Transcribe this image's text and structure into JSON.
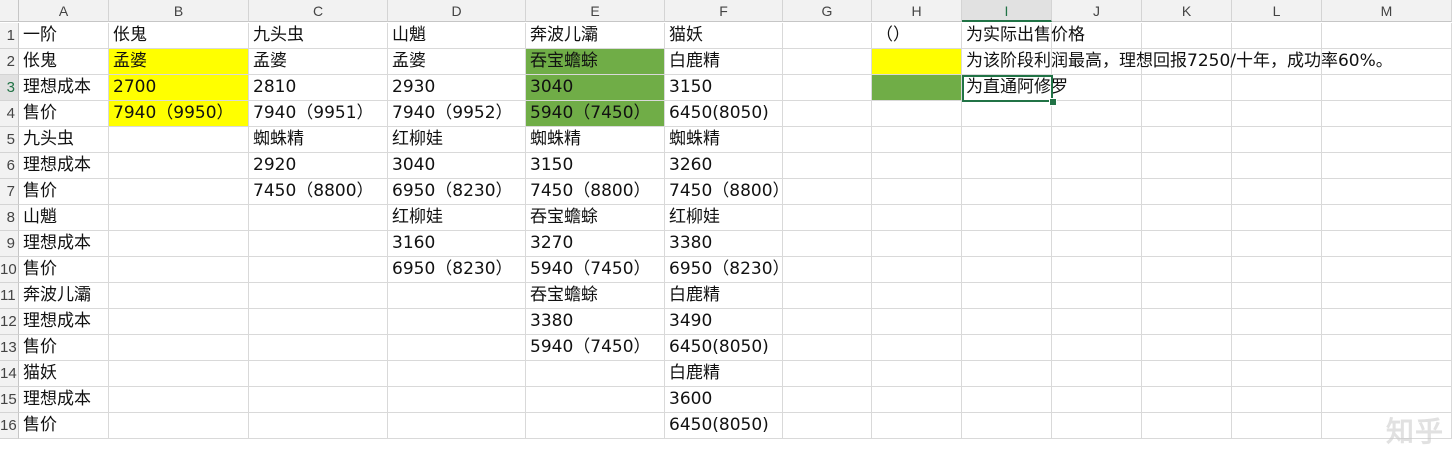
{
  "columns": [
    "A",
    "B",
    "C",
    "D",
    "E",
    "F",
    "G",
    "H",
    "I",
    "J",
    "K",
    "L",
    "M"
  ],
  "selected_column": "I",
  "selected_row": "3",
  "rows": [
    {
      "label": "1",
      "cells": {
        "A": "一阶",
        "B": "伥鬼",
        "C": "九头虫",
        "D": "山魈",
        "E": "奔波儿灞",
        "F": "猫妖",
        "H": "（）",
        "I": "为实际出售价格"
      }
    },
    {
      "label": "2",
      "cells": {
        "A": "伥鬼",
        "B": "孟婆",
        "C": "孟婆",
        "D": "孟婆",
        "E": "吞宝蟾蜍",
        "F": "白鹿精",
        "I": "为该阶段利润最高，理想回报7250/十年，成功率60%。"
      }
    },
    {
      "label": "3",
      "cells": {
        "A": "理想成本",
        "B": "2700",
        "C": "2810",
        "D": "2930",
        "E": "3040",
        "F": "3150",
        "I": "为直通阿修罗"
      }
    },
    {
      "label": "4",
      "cells": {
        "A": "售价",
        "B": "7940（9950）",
        "C": "7940（9951）",
        "D": "7940（9952）",
        "E": "5940（7450）",
        "F": "6450(8050)"
      }
    },
    {
      "label": "5",
      "cells": {
        "A": "九头虫",
        "C": "蜘蛛精",
        "D": "红柳娃",
        "E": "蜘蛛精",
        "F": "蜘蛛精"
      }
    },
    {
      "label": "6",
      "cells": {
        "A": "理想成本",
        "C": "2920",
        "D": "3040",
        "E": "3150",
        "F": "3260"
      }
    },
    {
      "label": "7",
      "cells": {
        "A": "售价",
        "C": "7450（8800）",
        "D": "6950（8230）",
        "E": "7450（8800）",
        "F": "7450（8800）"
      }
    },
    {
      "label": "8",
      "cells": {
        "A": "山魈",
        "D": "红柳娃",
        "E": "吞宝蟾蜍",
        "F": "红柳娃"
      }
    },
    {
      "label": "9",
      "cells": {
        "A": "理想成本",
        "D": "3160",
        "E": "3270",
        "F": "3380"
      }
    },
    {
      "label": "10",
      "cells": {
        "A": "售价",
        "D": "6950（8230）",
        "E": "5940（7450）",
        "F": "6950（8230）"
      }
    },
    {
      "label": "11",
      "cells": {
        "A": "奔波儿灞",
        "E": "吞宝蟾蜍",
        "F": "白鹿精"
      }
    },
    {
      "label": "12",
      "cells": {
        "A": "理想成本",
        "E": "3380",
        "F": "3490"
      }
    },
    {
      "label": "13",
      "cells": {
        "A": "售价",
        "E": "5940（7450）",
        "F": "6450(8050)"
      }
    },
    {
      "label": "14",
      "cells": {
        "A": "猫妖",
        "F": "白鹿精"
      }
    },
    {
      "label": "15",
      "cells": {
        "A": "理想成本",
        "F": "3600"
      }
    },
    {
      "label": "16",
      "cells": {
        "A": "售价",
        "F": "6450(8050)"
      }
    }
  ],
  "highlights": [
    {
      "cell": "B2",
      "color": "#ffff00"
    },
    {
      "cell": "B3",
      "color": "#ffff00"
    },
    {
      "cell": "B4",
      "color": "#ffff00"
    },
    {
      "cell": "H2",
      "color": "#ffff00"
    },
    {
      "cell": "E2",
      "color": "#70ad47"
    },
    {
      "cell": "E3",
      "color": "#70ad47"
    },
    {
      "cell": "E4",
      "color": "#70ad47"
    },
    {
      "cell": "H3",
      "color": "#70ad47"
    }
  ],
  "colors": {
    "accent": "#217346",
    "header_bg": "#f2f2f2",
    "gridline": "#d9d9d9"
  },
  "watermark": "知乎"
}
